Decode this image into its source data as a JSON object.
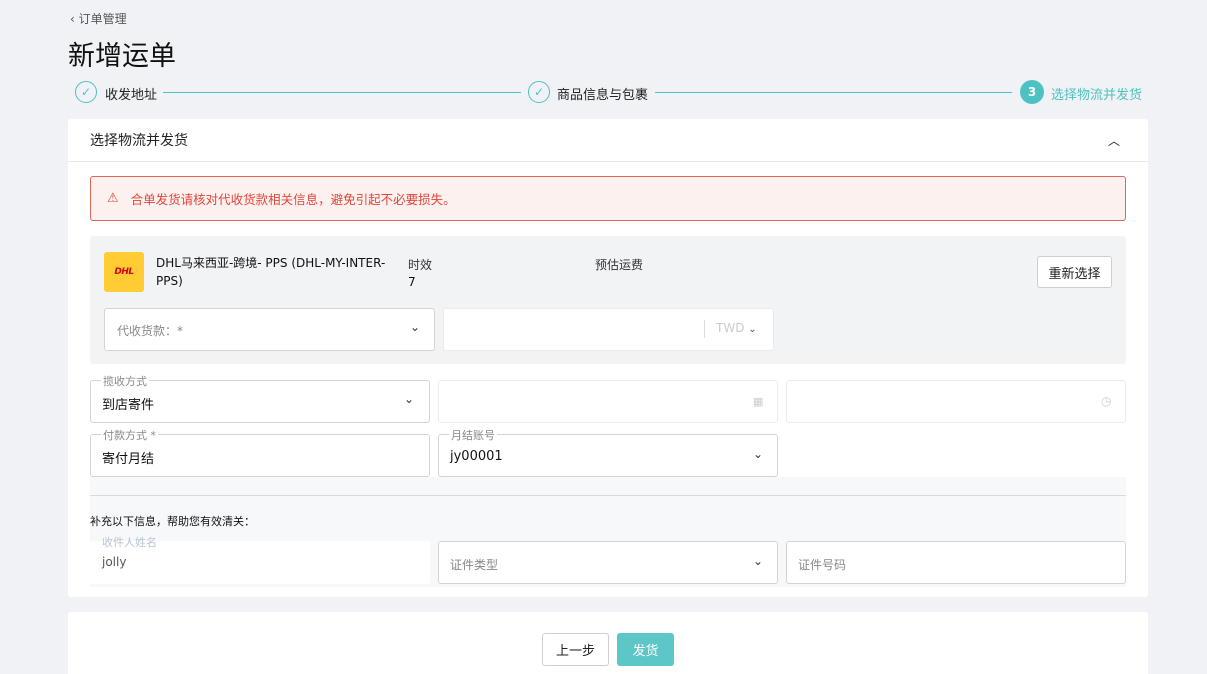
{
  "nav": {
    "back_label": "订单管理"
  },
  "page": {
    "title": "新增运单"
  },
  "steps": [
    {
      "label": "收发地址",
      "state": "done"
    },
    {
      "label": "商品信息与包裹",
      "state": "done"
    },
    {
      "label": "选择物流并发货",
      "state": "active",
      "number": "3"
    }
  ],
  "section": {
    "title": "选择物流并发货"
  },
  "alert": {
    "text": "合单发货请核对代收货款相关信息，避免引起不必要损失。"
  },
  "carrier": {
    "logo_text": "DHL",
    "name": "DHL马来西亚-跨境- PPS (DHL-MY-INTER-PPS)",
    "transit_label": "时效",
    "transit_value": "7",
    "fee_label": "预估运费",
    "reselect_label": "重新选择"
  },
  "cod": {
    "placeholder": "代收货款：*",
    "currency": "TWD"
  },
  "pickup": {
    "label": "揽收方式",
    "value": "到店寄件"
  },
  "payment": {
    "label": "付款方式 *",
    "value": "寄付月结"
  },
  "account": {
    "label": "月结账号",
    "value": "jy00001"
  },
  "supplement": {
    "heading": "补充以下信息，帮助您有效清关：",
    "recipient_label": "收件人姓名",
    "recipient_value": "jolly",
    "id_type_placeholder": "证件类型",
    "id_number_placeholder": "证件号码"
  },
  "footer": {
    "prev_label": "上一步",
    "ship_label": "发货"
  },
  "colors": {
    "accent": "#4ec2c2",
    "primary_button": "#5cc7c6",
    "alert": "#e0463a",
    "dhl_yellow": "#ffcc33",
    "dhl_red": "#d40511"
  },
  "icons": [
    "chevron-left-icon",
    "check-circle-icon",
    "chevron-up-icon",
    "warning-icon",
    "chevron-down-icon",
    "calendar-icon",
    "clock-icon"
  ]
}
